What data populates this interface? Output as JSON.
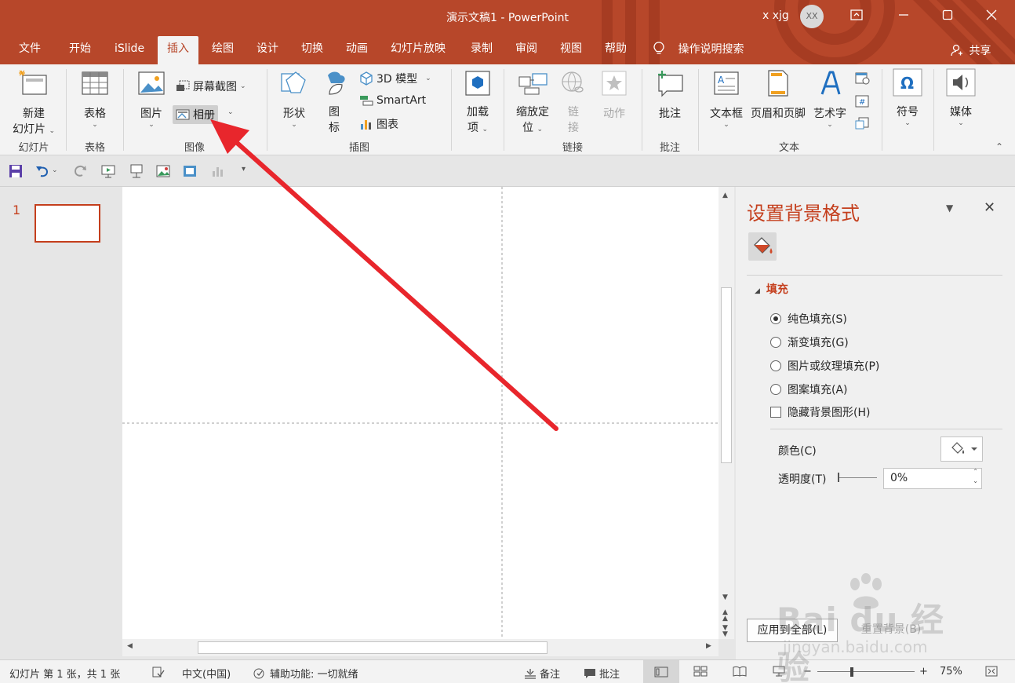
{
  "window": {
    "title": "演示文稿1  -  PowerPoint",
    "user": "x xjg",
    "avatar_initials": "XX"
  },
  "tabs": [
    "文件",
    "开始",
    "iSlide",
    "插入",
    "绘图",
    "设计",
    "切换",
    "动画",
    "幻灯片放映",
    "录制",
    "审阅",
    "视图",
    "帮助"
  ],
  "active_tab": "插入",
  "tell_me": "操作说明搜索",
  "share": "共享",
  "ribbon": {
    "new_slide_1": "新建",
    "new_slide_2": "幻灯片",
    "table": "表格",
    "picture": "图片",
    "screenshot": "屏幕截图",
    "album": "相册",
    "shapes": "形状",
    "icons_1": "图",
    "icons_2": "标",
    "model3d": "3D 模型",
    "smartart": "SmartArt",
    "chart": "图表",
    "addin_1": "加载",
    "addin_2": "项",
    "zoom_1": "缩放定",
    "zoom_2": "位",
    "link_1": "链",
    "link_2": "接",
    "action": "动作",
    "comment": "批注",
    "textbox": "文本框",
    "headerfooter": "页眉和页脚",
    "wordart": "艺术字",
    "symbol": "符号",
    "media": "媒体",
    "groups": {
      "slides": "幻灯片",
      "tables": "表格",
      "images": "图像",
      "illustrations": "插图",
      "links": "链接",
      "comments": "批注",
      "text": "文本"
    }
  },
  "thumbs": {
    "number": "1"
  },
  "pane": {
    "title": "设置背景格式",
    "section": "填充",
    "options": [
      "纯色填充(S)",
      "渐变填充(G)",
      "图片或纹理填充(P)",
      "图案填充(A)"
    ],
    "hide_bg": "隐藏背景图形(H)",
    "color_label": "颜色(C)",
    "transparency_label": "透明度(T)",
    "transparency_value": "0%",
    "apply_all": "应用到全部(L)",
    "reset": "重置背景(B)"
  },
  "status": {
    "slide_info": "幻灯片 第 1 张，共 1 张",
    "language": "中文(中国)",
    "accessibility": "辅助功能: 一切就绪",
    "notes": "备注",
    "comments": "批注",
    "zoom": "75%"
  },
  "watermark": {
    "logo": "Bai du 经验",
    "url": "jingyan.baidu.com"
  },
  "colors": {
    "accent": "#b7472a",
    "pane_title": "#c43e1c",
    "arrow": "#e8262c"
  }
}
